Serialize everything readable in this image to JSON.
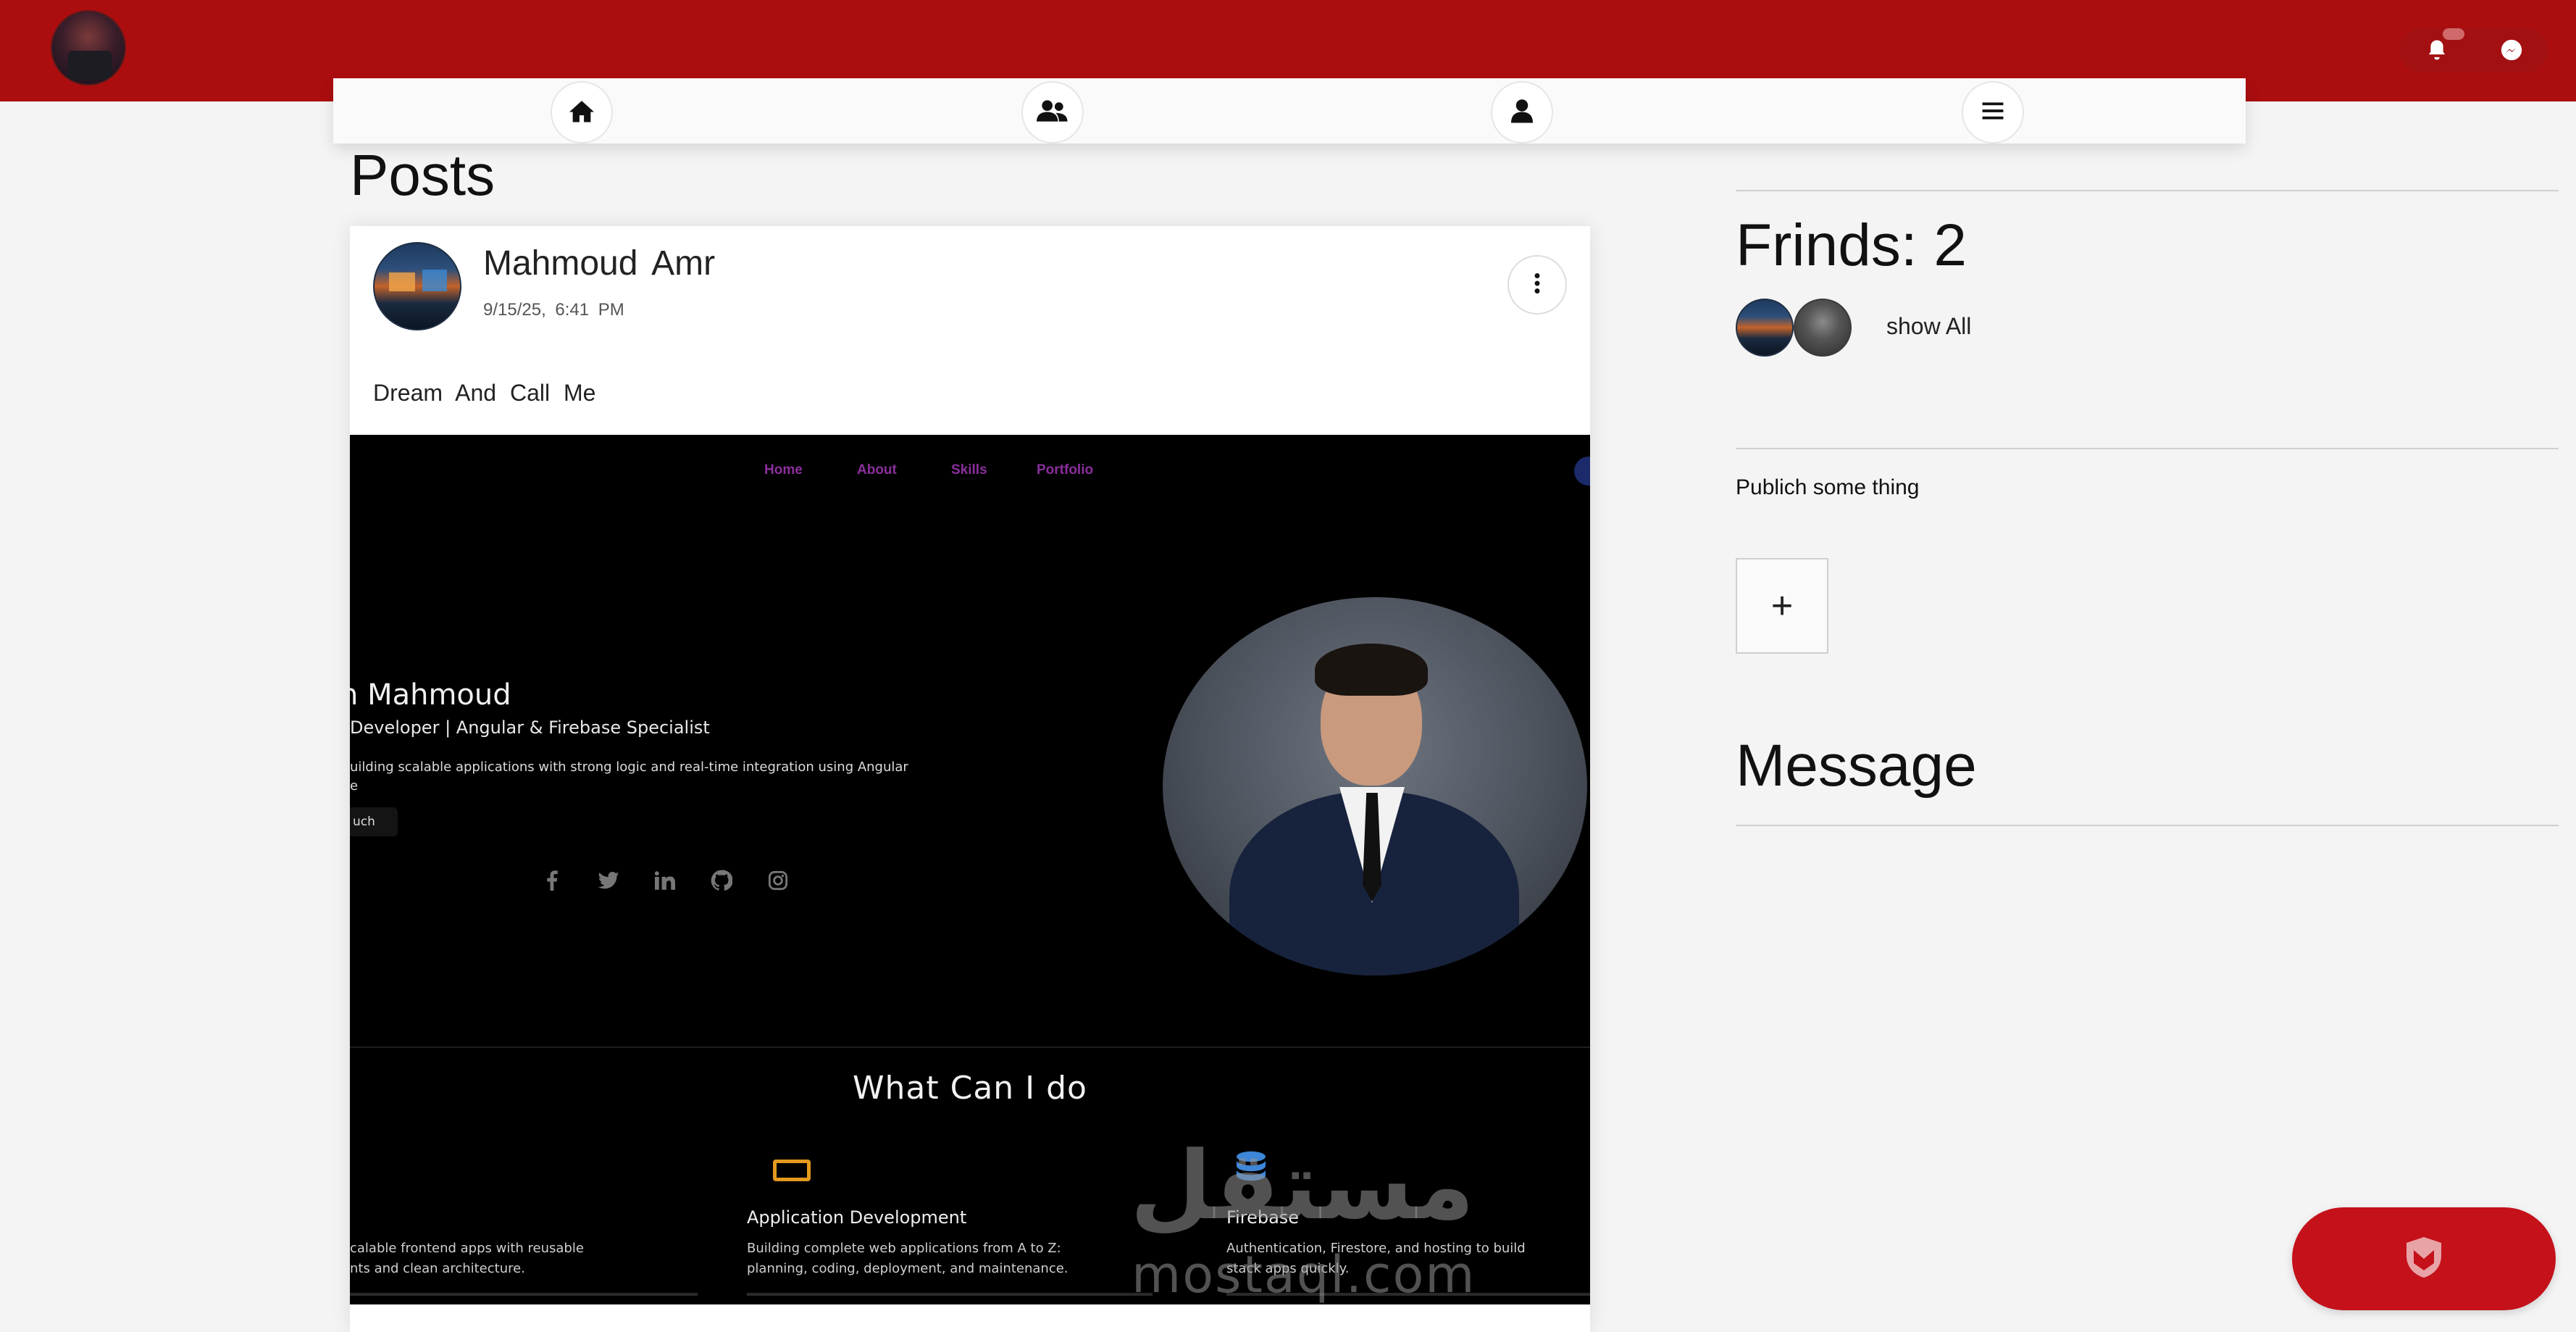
{
  "header": {
    "actions": {
      "notifications_icon": "bell-icon",
      "messenger_icon": "messenger-icon"
    }
  },
  "nav": {
    "items": [
      {
        "name": "home",
        "icon": "home-icon"
      },
      {
        "name": "friends",
        "icon": "users-icon"
      },
      {
        "name": "profile",
        "icon": "user-icon"
      },
      {
        "name": "menu",
        "icon": "menu-icon"
      }
    ]
  },
  "posts": {
    "title": "Posts",
    "items": [
      {
        "author": "Mahmoud  Amr",
        "date": "9/15/25,  6:41  PM",
        "text": "Dream  And  Call  Me",
        "image": {
          "nav": [
            "Home",
            "About",
            "Skills",
            "Portfolio"
          ],
          "hero_name": "n Mahmoud",
          "hero_role": " Developer | Angular & Firebase Specialist",
          "hero_desc_line1": "uilding scalable applications with strong logic and real-time integration using Angular",
          "hero_desc_line2": "e",
          "hero_button": "uch",
          "section_title": "What Can I do",
          "services": [
            {
              "title": "",
              "desc1": "calable frontend apps with reusable",
              "desc2": "nts and clean architecture."
            },
            {
              "title": "Application Development",
              "desc1": "Building complete web applications from A to Z:",
              "desc2": "planning, coding, deployment, and maintenance."
            },
            {
              "title": "Firebase",
              "desc1": "Authentication, Firestore, and hosting to build",
              "desc2": "stack apps quickly."
            }
          ]
        }
      }
    ]
  },
  "watermark": {
    "arabic": "مستقل",
    "latin": "mostaql.com"
  },
  "sidebar": {
    "friends_title": "Frinds: 2",
    "show_all": "show All",
    "publish_label": "Publich some thing",
    "add_button": "+",
    "message_title": "Message"
  },
  "colors": {
    "brand_red": "#ac0d0f",
    "fab_red": "#c4111a",
    "portfolio_nav": "#8a2f9c",
    "service_icon": "#e39a1e"
  }
}
